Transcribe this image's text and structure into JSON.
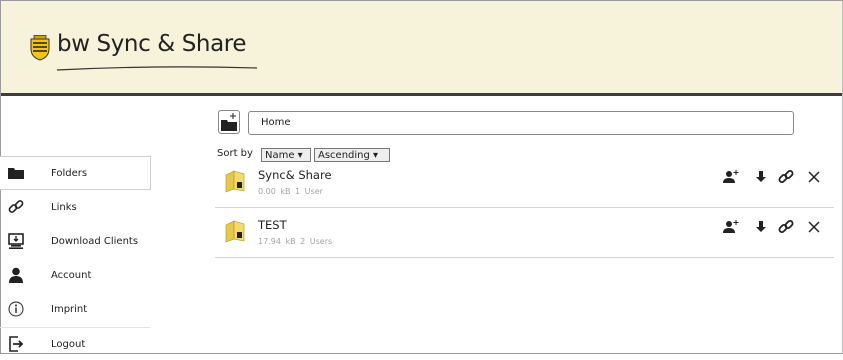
{
  "brand": {
    "logo_text": "bw Sync & Share"
  },
  "colors": {
    "header_bg": "#f7f2da",
    "header_border": "#3d3d3d",
    "folder_yellow": "#e6c84a"
  },
  "sidebar": {
    "items": [
      {
        "label": "Folders",
        "icon": "folder-icon",
        "active": true
      },
      {
        "label": "Links",
        "icon": "link-icon",
        "active": false
      },
      {
        "label": "Download Clients",
        "icon": "download-clients-icon",
        "active": false
      },
      {
        "label": "Account",
        "icon": "user-icon",
        "active": false
      },
      {
        "label": "Imprint",
        "icon": "info-icon",
        "active": false
      },
      {
        "label": "Logout",
        "icon": "logout-icon",
        "active": false
      }
    ]
  },
  "toolbar": {
    "path": "Home",
    "new_folder_icon": "new-folder-icon"
  },
  "sort": {
    "label": "Sort by",
    "field": "Name ▾",
    "order": "Ascending ▾"
  },
  "folders": [
    {
      "name": "Sync& Share",
      "size": "0.00 kB",
      "users": "1 User"
    },
    {
      "name": "TEST",
      "size": "17.94 kB",
      "users": "2 Users"
    }
  ],
  "row_actions": [
    "share-user-icon",
    "download-icon",
    "link-icon",
    "delete-icon"
  ]
}
